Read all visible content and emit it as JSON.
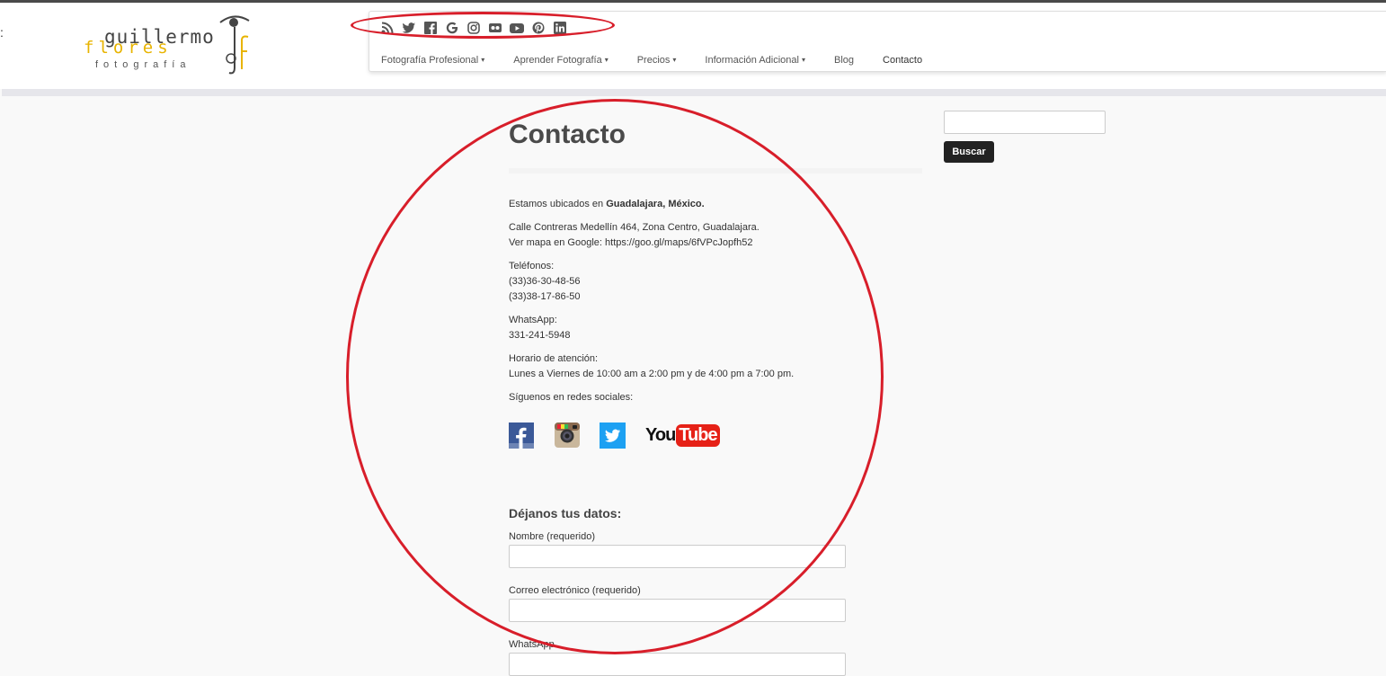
{
  "logo": {
    "line1": "guillermo",
    "line2": "flores",
    "line3": "fotografía",
    "mark": "g f"
  },
  "social_icons": [
    "rss-icon",
    "twitter-icon",
    "facebook-icon",
    "google-icon",
    "instagram-icon",
    "flickr-icon",
    "youtube-icon",
    "pinterest-icon",
    "linkedin-icon"
  ],
  "nav": {
    "items": [
      {
        "label": "Fotografía Profesional",
        "dropdown": true
      },
      {
        "label": "Aprender Fotografía",
        "dropdown": true
      },
      {
        "label": "Precios",
        "dropdown": true
      },
      {
        "label": "Información Adicional",
        "dropdown": true
      },
      {
        "label": "Blog",
        "dropdown": false
      },
      {
        "label": "Contacto",
        "dropdown": false
      }
    ],
    "caret": "▾"
  },
  "page": {
    "title": "Contacto",
    "location_prefix": "Estamos ubicados en ",
    "location_bold": "Guadalajara, México.",
    "address": "Calle Contreras Medellín 464, Zona Centro, Guadalajara.",
    "map_line": "Ver mapa en Google: https://goo.gl/maps/6fVPcJopfh52",
    "phones_label": "Teléfonos:",
    "phone1": "(33)36-30-48-56",
    "phone2": "(33)38-17-86-50",
    "whatsapp_label": "WhatsApp:",
    "whatsapp_number": "331-241-5948",
    "hours_label": "Horario de atención:",
    "hours": "Lunes a Viernes de 10:00 am a 2:00 pm y de 4:00 pm a 7:00 pm.",
    "follow": "Síguenos en redes sociales:",
    "youtube_you": "You",
    "youtube_tube": "Tube"
  },
  "form": {
    "heading": "Déjanos tus datos:",
    "name_label": "Nombre (requerido)",
    "email_label": "Correo electrónico (requerido)",
    "whatsapp_label": "WhatsApp"
  },
  "sidebar": {
    "search_button": "Buscar"
  },
  "colors": {
    "annotation": "#d81e2a",
    "logo_yellow": "#e8b400",
    "facebook": "#3b5998",
    "twitter": "#1da1f2",
    "youtube": "#e62117"
  }
}
